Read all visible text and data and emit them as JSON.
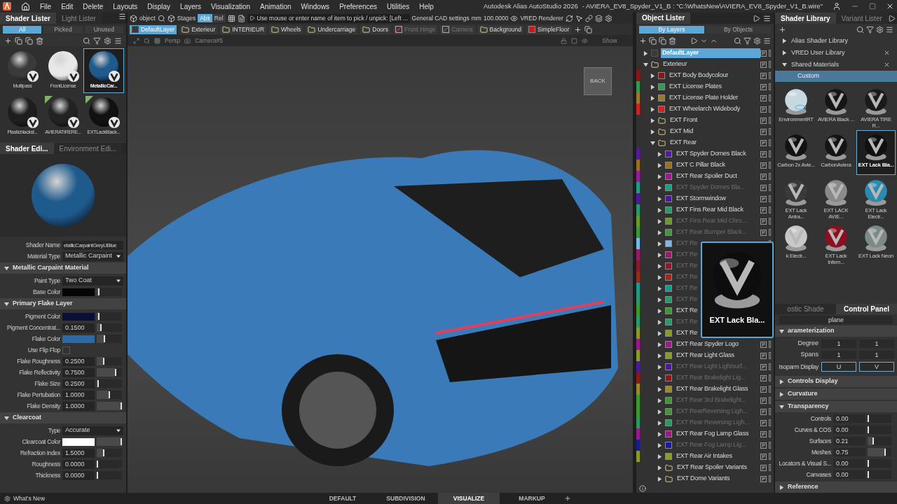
{
  "menu_bar": {
    "items": [
      "File",
      "Edit",
      "Delete",
      "Layouts",
      "Display",
      "Layers",
      "Visualization",
      "Animation",
      "Windows",
      "Preferences",
      "Utilities",
      "Help"
    ],
    "app_title": "Autodesk Alias AutoStudio 2026",
    "file_title": "- AVIERA_EV8_Spyder_V1_B : \"C:\\WhatsNew\\AVIERA_EV8_Spyder_V1_B.wire\""
  },
  "shader_lister": {
    "tabs": [
      {
        "label": "Shader Lister",
        "selected": true
      },
      {
        "label": "Light Lister",
        "selected": false
      }
    ],
    "filters": [
      {
        "label": "All",
        "selected": true
      },
      {
        "label": "Picked",
        "selected": false
      },
      {
        "label": "Unused",
        "selected": false
      }
    ],
    "shaders": [
      {
        "label": "Multipass",
        "color": "#3a3a3a",
        "selected": false,
        "linked": false
      },
      {
        "label": "FrontLicense",
        "color": "#e8e8e8",
        "selected": false,
        "linked": false
      },
      {
        "label": "MetallicCar...",
        "color": "#1f5a8c",
        "selected": true,
        "linked": false
      },
      {
        "label": "Plasticblackst...",
        "color": "#1e1e1e",
        "selected": false,
        "linked": false
      },
      {
        "label": "AVIERATIRERE...",
        "color": "#222222",
        "selected": false,
        "linked": true
      },
      {
        "label": "EXTLackBlack...",
        "color": "#111111",
        "selected": false,
        "linked": true
      }
    ]
  },
  "shader_editor": {
    "tabs": [
      {
        "label": "Shader Edi...",
        "selected": true
      },
      {
        "label": "Environment Edi...",
        "selected": false
      }
    ],
    "fields": [
      {
        "label": "Shader Name",
        "kind": "text",
        "value": "etallicCarpaintGreyLtBlue"
      },
      {
        "label": "Material Type",
        "kind": "dropdown",
        "value": "Metallic Carpaint"
      }
    ],
    "sections": [
      {
        "title": "Metallic Carpaint Material",
        "expanded": true,
        "fields": [
          {
            "label": "Paint Type",
            "kind": "dropdown",
            "value": "Two Coat"
          },
          {
            "label": "Base Color",
            "kind": "color",
            "color": "#050505",
            "level": 0.05
          }
        ]
      },
      {
        "title": "Primary Flake Layer",
        "expanded": true,
        "fields": [
          {
            "label": "Pigment Color",
            "kind": "color",
            "color": "#0a0f3a",
            "level": 0.05
          },
          {
            "label": "Pigment Concentrat...",
            "kind": "number",
            "value": "0.1500",
            "level": 0.15
          },
          {
            "label": "Flake Color",
            "kind": "color",
            "color": "#2b6aa6",
            "level": 0.3
          },
          {
            "label": "Use Flip Flop",
            "kind": "checkbox",
            "checked": false
          },
          {
            "label": "Flake Roughness",
            "kind": "number",
            "value": "0.2500",
            "level": 0.25
          },
          {
            "label": "Flake Reflectivity",
            "kind": "number",
            "value": "0.7500",
            "level": 0.75
          },
          {
            "label": "Flake Size",
            "kind": "number",
            "value": "0.2500",
            "level": 0.02
          },
          {
            "label": "Flake Pertubation",
            "kind": "number",
            "value": "1.0000",
            "level": 0.5
          },
          {
            "label": "Flake Density",
            "kind": "number",
            "value": "1.0000",
            "level": 1
          }
        ]
      },
      {
        "title": "Clearcoat",
        "expanded": true,
        "fields": [
          {
            "label": "Type",
            "kind": "dropdown",
            "value": "Accurate"
          },
          {
            "label": "Clearcoat Color",
            "kind": "color",
            "color": "#ffffff",
            "level": 1
          },
          {
            "label": "Refraction Index",
            "kind": "number",
            "value": "1.5000",
            "level": 0.25
          },
          {
            "label": "Roughness",
            "kind": "number",
            "value": "0.0000",
            "level": 0
          },
          {
            "label": "Thickness",
            "kind": "number",
            "value": "0.0000",
            "level": 0
          }
        ]
      }
    ]
  },
  "toolbar": {
    "pick_mode": "object",
    "stages": "Stages",
    "modes": [
      {
        "label": "Abs",
        "selected": true
      },
      {
        "label": "Rel",
        "selected": false
      }
    ],
    "prompt": "Use mouse or enter name of item to pick / unpick: [Left ...",
    "settings": "General CAD settings",
    "unit": "mm",
    "tolerance": "100.0000",
    "renderer": "VRED Renderer"
  },
  "layer_bar": [
    {
      "label": "DefaultLayer",
      "kind": "default",
      "selected": true,
      "dimmed": false
    },
    {
      "label": "Exterieur",
      "kind": "folder",
      "selected": false,
      "dimmed": false
    },
    {
      "label": "INTERIEUR",
      "kind": "folder",
      "selected": false,
      "dimmed": false
    },
    {
      "label": "Wheels",
      "kind": "folder",
      "selected": false,
      "dimmed": false
    },
    {
      "label": "Undercarriage",
      "kind": "folder",
      "selected": false,
      "dimmed": false
    },
    {
      "label": "Doors",
      "kind": "folder",
      "selected": false,
      "dimmed": false
    },
    {
      "label": "Front Hinge",
      "kind": "camera",
      "selected": false,
      "dimmed": true
    },
    {
      "label": "Camera",
      "kind": "camera",
      "selected": false,
      "dimmed": true
    },
    {
      "label": "Background",
      "kind": "folder",
      "selected": false,
      "dimmed": false
    },
    {
      "label": "SimpleFloor",
      "kind": "swatch",
      "selected": false,
      "dimmed": false,
      "color": "#d01818"
    }
  ],
  "viewport": {
    "view": "Persp",
    "camera": "Camera#5",
    "show": "Show",
    "view_cube": "BACK"
  },
  "object_lister": {
    "title": "Object Lister",
    "tabs": [
      {
        "label": "By Layers",
        "selected": true
      },
      {
        "label": "By Objects",
        "selected": false
      }
    ],
    "items": [
      {
        "label": "DefaultLayer",
        "kind": "default",
        "expanded": false,
        "selected": true,
        "dimmed": false,
        "pick": "P"
      },
      {
        "label": "Exterieur",
        "kind": "folder",
        "expanded": true,
        "selected": false,
        "dimmed": false,
        "pick": "P",
        "children": [
          {
            "label": "EXT Body Bodycolour",
            "kind": "layer",
            "expanded": false,
            "selected": false,
            "dimmed": false,
            "color": "#8b1515",
            "pick": "P"
          },
          {
            "label": "EXT License Plates",
            "kind": "layer",
            "expanded": false,
            "selected": false,
            "dimmed": false,
            "color": "#2e9e4e",
            "pick": "P"
          },
          {
            "label": "EXT License Plate Holder",
            "kind": "layer",
            "expanded": false,
            "selected": false,
            "dimmed": false,
            "color": "#9a7a2a",
            "pick": "P"
          },
          {
            "label": "EXT Wheelarch Widebody",
            "kind": "layer",
            "expanded": false,
            "selected": false,
            "dimmed": false,
            "color": "#d42020",
            "pick": "P"
          },
          {
            "label": "EXT Front",
            "kind": "folder",
            "expanded": false,
            "selected": false,
            "dimmed": false,
            "pick": "P"
          },
          {
            "label": "EXT Mid",
            "kind": "folder",
            "expanded": false,
            "selected": false,
            "dimmed": false,
            "pick": "P"
          },
          {
            "label": "EXT Rear",
            "kind": "folder",
            "expanded": true,
            "selected": false,
            "dimmed": false,
            "pick": "P",
            "children": [
              {
                "label": "EXT Spyder Domes Black",
                "kind": "layer",
                "expanded": false,
                "selected": false,
                "dimmed": false,
                "color": "#541a9a",
                "pick": "P"
              },
              {
                "label": "EXT C Pillar Black",
                "kind": "layer",
                "expanded": false,
                "selected": false,
                "dimmed": false,
                "color": "#9a7020",
                "pick": "P"
              },
              {
                "label": "EXT Rear Spoiler Duct",
                "kind": "layer",
                "expanded": false,
                "selected": false,
                "dimmed": false,
                "color": "#9a1a9a",
                "pick": "P"
              },
              {
                "label": "EXT Spyder Domes Bla...",
                "kind": "layer",
                "expanded": false,
                "selected": false,
                "dimmed": true,
                "color": "#1ea080",
                "pick": "P"
              },
              {
                "label": "EXT Stormwindow",
                "kind": "layer",
                "expanded": false,
                "selected": false,
                "dimmed": false,
                "color": "#4a1a9a",
                "pick": "P"
              },
              {
                "label": "EXT Fins Rear Mid Black",
                "kind": "layer",
                "expanded": false,
                "selected": false,
                "dimmed": false,
                "color": "#2a9a6a",
                "pick": "P"
              },
              {
                "label": "EXT Fins Rear Mid Chro...",
                "kind": "layer",
                "expanded": false,
                "selected": false,
                "dimmed": true,
                "color": "#6a9a2a",
                "pick": "P"
              },
              {
                "label": "EXT Rear Bumper Black...",
                "kind": "layer",
                "expanded": false,
                "selected": false,
                "dimmed": true,
                "color": "#3a9a3a",
                "pick": "P"
              },
              {
                "label": "EXT Re",
                "kind": "layer",
                "expanded": false,
                "selected": false,
                "dimmed": true,
                "color": "#7ab8e8"
              },
              {
                "label": "EXT Re",
                "kind": "layer",
                "expanded": false,
                "selected": false,
                "dimmed": true,
                "color": "#9a1a6a"
              },
              {
                "label": "EXT Re",
                "kind": "layer",
                "expanded": false,
                "selected": false,
                "dimmed": true,
                "color": "#8a1a2a"
              },
              {
                "label": "EXT Re",
                "kind": "layer",
                "expanded": false,
                "selected": false,
                "dimmed": true,
                "color": "#9a2a1a"
              },
              {
                "label": "EXT Re",
                "kind": "layer",
                "expanded": false,
                "selected": false,
                "dimmed": true,
                "color": "#1a9a8a"
              },
              {
                "label": "EXT Re",
                "kind": "layer",
                "expanded": false,
                "selected": false,
                "dimmed": true,
                "color": "#2a9a6a"
              },
              {
                "label": "EXT Re",
                "kind": "layer",
                "expanded": false,
                "selected": false,
                "dimmed": false,
                "color": "#3a9a2a"
              },
              {
                "label": "EXT Re",
                "kind": "layer",
                "expanded": false,
                "selected": false,
                "dimmed": true,
                "color": "#2a9a6b"
              },
              {
                "label": "EXT Re",
                "kind": "layer",
                "expanded": false,
                "selected": false,
                "dimmed": false,
                "color": "#8a9a2a"
              },
              {
                "label": "EXT Rear Spyder Logo",
                "kind": "layer",
                "expanded": false,
                "selected": false,
                "dimmed": false,
                "color": "#9a1a8a",
                "pick": "P"
              },
              {
                "label": "EXT Rear Light Glass",
                "kind": "layer",
                "expanded": false,
                "selected": false,
                "dimmed": false,
                "color": "#8a9a2b",
                "pick": "P"
              },
              {
                "label": "EXT Rear Light Lightsurf...",
                "kind": "layer",
                "expanded": false,
                "selected": false,
                "dimmed": true,
                "color": "#4a1a9b",
                "pick": "P"
              },
              {
                "label": "EXT Rear Brakelight Lig...",
                "kind": "layer",
                "expanded": false,
                "selected": false,
                "dimmed": true,
                "color": "#8a1a1a",
                "pick": "P"
              },
              {
                "label": "EXT Rear Brakelight Glass",
                "kind": "layer",
                "expanded": false,
                "selected": false,
                "dimmed": false,
                "color": "#9a8a2a",
                "pick": "P"
              },
              {
                "label": "EXT Rear 3rd Brakelight...",
                "kind": "layer",
                "expanded": false,
                "selected": false,
                "dimmed": true,
                "color": "#3a9a2b",
                "pick": "P"
              },
              {
                "label": "EXT RearReversing Ligh...",
                "kind": "layer",
                "expanded": false,
                "selected": false,
                "dimmed": true,
                "color": "#3a9a2c",
                "pick": "P"
              },
              {
                "label": "EXT Rear Reversing Ligh...",
                "kind": "layer",
                "expanded": false,
                "selected": false,
                "dimmed": true,
                "color": "#2a9a5a",
                "pick": "P"
              },
              {
                "label": "EXT Rear Fog Lamp Glass",
                "kind": "layer",
                "expanded": false,
                "selected": false,
                "dimmed": false,
                "color": "#9a1a8b",
                "pick": "P"
              },
              {
                "label": "EXT Rear Fog Lamp Lig...",
                "kind": "layer",
                "expanded": false,
                "selected": false,
                "dimmed": true,
                "color": "#1a1a9a",
                "pick": "P"
              },
              {
                "label": "EXT Rear Air Intakes",
                "kind": "layer",
                "expanded": false,
                "selected": false,
                "dimmed": false,
                "color": "#8a9a2c",
                "pick": "P"
              },
              {
                "label": "EXT Rear Spoiler Variants",
                "kind": "folder",
                "expanded": false,
                "selected": false,
                "dimmed": false,
                "pick": "P"
              },
              {
                "label": "EXT Dome Variants",
                "kind": "folder",
                "expanded": false,
                "selected": false,
                "dimmed": false,
                "pick": "P"
              }
            ]
          }
        ]
      }
    ]
  },
  "preview_popup": {
    "label": "EXT Lack  Bla..."
  },
  "shader_library": {
    "tabs": [
      {
        "label": "Shader Library",
        "selected": true
      },
      {
        "label": "Variant Lister",
        "selected": false
      }
    ],
    "tree": [
      {
        "label": "Alias Shader Library",
        "expanded": false,
        "closable": false
      },
      {
        "label": "VRED User Library",
        "expanded": false,
        "closable": true
      },
      {
        "label": "Shared Materials",
        "expanded": true,
        "closable": true
      }
    ],
    "folder": {
      "label": "Custom",
      "selected": true
    },
    "shaders": [
      {
        "label": "EnvironmentRT",
        "kind": "environment",
        "color": "#c8d8e0",
        "selected": false
      },
      {
        "label": "AVIERA Black ...",
        "kind": "shader",
        "color": "#151515",
        "selected": false
      },
      {
        "label": "AVIERA TIRE R...",
        "kind": "shader",
        "color": "#1a1a1a",
        "selected": false
      },
      {
        "label": "Carbon 2x Avie...",
        "kind": "shader",
        "color": "#121212",
        "selected": false
      },
      {
        "label": "CarbonAviera",
        "kind": "shader",
        "color": "#141414",
        "selected": false
      },
      {
        "label": "EXT Lack  Bla...",
        "kind": "shader",
        "color": "#101010",
        "selected": true
      },
      {
        "label": "EXT Lack Antra...",
        "kind": "shader",
        "color": "#3a3a3a",
        "selected": false
      },
      {
        "label": "EXT LACK AVIE...",
        "kind": "shader",
        "color": "#8a8a8a",
        "selected": false
      },
      {
        "label": "EXT Lack Electr...",
        "kind": "shader",
        "color": "#2a8ab0",
        "selected": false
      },
      {
        "label": "k Electr...",
        "kind": "shader",
        "color": "#c8c8c8",
        "selected": false
      },
      {
        "label": "EXT Lack Infern...",
        "kind": "shader",
        "color": "#8a1020",
        "selected": false
      },
      {
        "label": "EXT Lack Neon",
        "kind": "shader",
        "color": "#7a8a88",
        "selected": false
      }
    ]
  },
  "control_panel": {
    "tabs": [
      {
        "label": "ostic Shade",
        "selected": false
      },
      {
        "label": "Control Panel",
        "selected": true
      }
    ],
    "object": "plane",
    "parameterization": {
      "title": "arameterization",
      "expanded": true,
      "rows": [
        {
          "label": "Degree",
          "values": [
            "1",
            "1"
          ]
        },
        {
          "label": "Spans",
          "values": [
            "1",
            "1"
          ]
        }
      ],
      "isoparm": {
        "label": "Isoparm Display",
        "toggles": [
          {
            "label": "U",
            "selected": true
          },
          {
            "label": "V",
            "selected": true
          }
        ]
      }
    },
    "sections": [
      {
        "title": "Controls Display",
        "expanded": false
      },
      {
        "title": "Curvature",
        "expanded": false
      },
      {
        "title": "Transparency",
        "expanded": true,
        "fields": [
          {
            "label": "Controls",
            "value": "0.00",
            "level": 0
          },
          {
            "label": "Curves & COS",
            "value": "0.00",
            "level": 0
          },
          {
            "label": "Surfaces",
            "value": "0.21",
            "level": 0.21
          },
          {
            "label": "Meshes",
            "value": "0.75",
            "level": 0.75
          },
          {
            "label": "Locators & Visual S...",
            "value": "0.00",
            "level": 0
          },
          {
            "label": "Canvases",
            "value": "0.00",
            "level": 0
          }
        ]
      },
      {
        "title": "Reference",
        "expanded": false
      }
    ]
  },
  "status_bar": {
    "whats_new": "What's New",
    "modes": [
      {
        "label": "DEFAULT",
        "selected": false
      },
      {
        "label": "SUBDIVISION",
        "selected": false
      },
      {
        "label": "VISUALIZE",
        "selected": true
      },
      {
        "label": "MARKUP",
        "selected": false
      }
    ]
  }
}
